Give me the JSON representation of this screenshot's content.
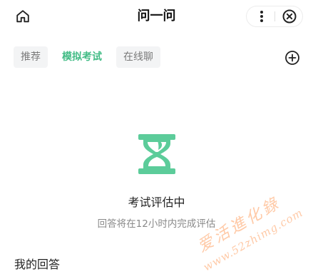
{
  "header": {
    "title": "问一问",
    "home_icon": "home-icon",
    "more_icon": "more-vertical-icon",
    "close_icon": "close-circle-icon"
  },
  "tabs": [
    {
      "label": "推荐",
      "active": false
    },
    {
      "label": "模拟考试",
      "active": true
    },
    {
      "label": "在线聊",
      "active": false
    }
  ],
  "add_icon": "plus-circle-icon",
  "status": {
    "icon": "hourglass-icon",
    "title": "考试评估中",
    "subtitle": "回答将在12小时内完成评估"
  },
  "section": {
    "title": "我的回答"
  },
  "watermark": {
    "text": "爱活進化錄",
    "url": "www.52zhimg.com"
  },
  "colors": {
    "accent": "#43bc86",
    "hourglass": "#5ccc9a",
    "tab_bg": "#f3f4f5",
    "watermark": "#ff8a3c"
  }
}
